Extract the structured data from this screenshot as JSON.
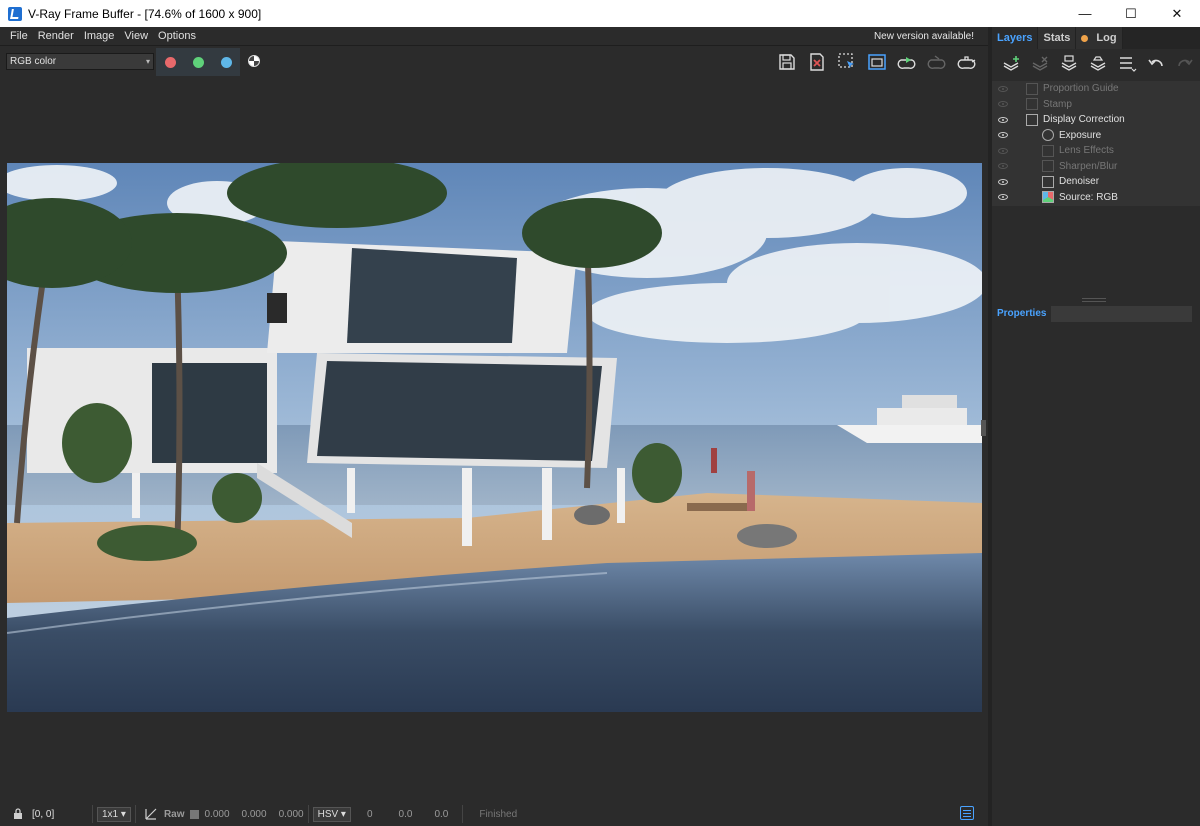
{
  "window": {
    "title": "V-Ray Frame Buffer - [74.6% of 1600 x 900]",
    "minimize": "—",
    "maximize": "☐",
    "close": "✕"
  },
  "menu": {
    "items": [
      "File",
      "Render",
      "Image",
      "View",
      "Options"
    ],
    "notice": "New version available!"
  },
  "toolbar": {
    "channel": "RGB color",
    "color_buttons": [
      {
        "name": "red-channel",
        "color": "#e8696b"
      },
      {
        "name": "green-channel",
        "color": "#5fd17a"
      },
      {
        "name": "blue-channel",
        "color": "#5fb7e8"
      }
    ],
    "right_icons": [
      "save-icon",
      "clear-icon",
      "region-render-icon",
      "track-mouse-icon",
      "render-icon",
      "render-interactive-icon",
      "teapot-icon"
    ]
  },
  "status": {
    "coords": "[0, 0]",
    "zoom": "1x1",
    "raw_label": "Raw",
    "rgb_values": [
      "0.000",
      "0.000",
      "0.000"
    ],
    "colorspace": "HSV",
    "hsv_values": [
      "0",
      "0.0",
      "0.0"
    ],
    "state": "Finished"
  },
  "panel": {
    "tabs": [
      "Layers",
      "Stats",
      "Log"
    ],
    "layers": [
      {
        "label": "Proportion Guide",
        "visible": false,
        "level": 0
      },
      {
        "label": "Stamp",
        "visible": false,
        "level": 0
      },
      {
        "label": "Display Correction",
        "visible": true,
        "level": 0
      },
      {
        "label": "Exposure",
        "visible": true,
        "level": 1
      },
      {
        "label": "Lens Effects",
        "visible": false,
        "level": 1
      },
      {
        "label": "Sharpen/Blur",
        "visible": false,
        "level": 1
      },
      {
        "label": "Denoiser",
        "visible": true,
        "level": 1
      },
      {
        "label": "Source: RGB",
        "visible": true,
        "level": 1
      }
    ],
    "properties": "Properties"
  },
  "colors": {
    "accent": "#4aa3ff",
    "log_dot": "#f0a34a"
  }
}
